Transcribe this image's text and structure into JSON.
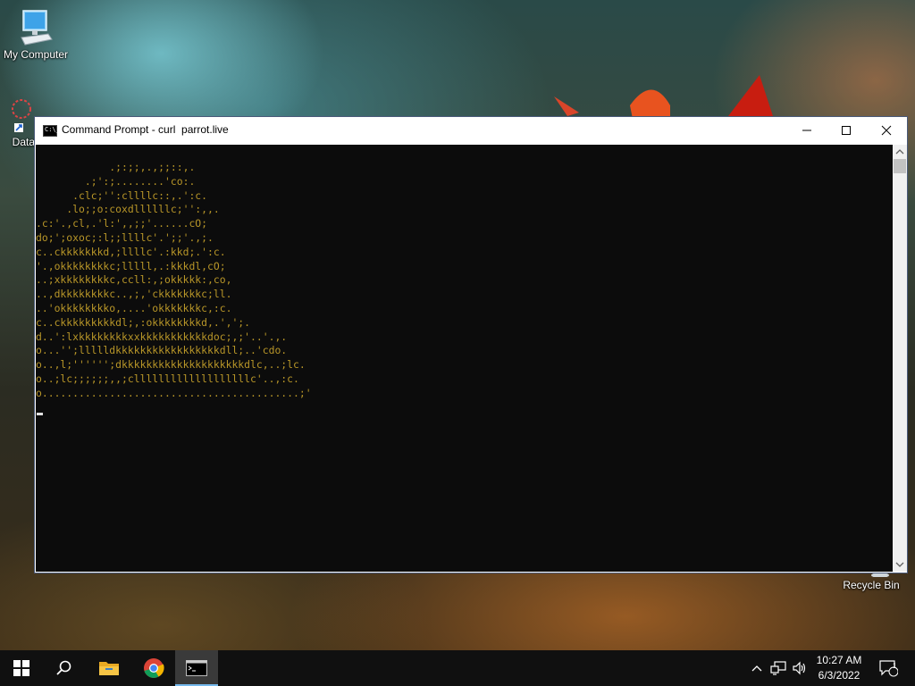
{
  "desktop": {
    "icons": [
      {
        "label": "My Computer",
        "icon": "computer-icon"
      },
      {
        "label": "DataW",
        "icon": "shortcut-icon"
      },
      {
        "label": "Recycle Bin",
        "icon": "recycle-bin-icon"
      }
    ]
  },
  "window": {
    "title": "Command Prompt - curl  parrot.live",
    "icon": "cmd-icon",
    "app_icon_text": "C:\\_",
    "controls": [
      "minimize-icon",
      "maximize-icon",
      "close-icon"
    ]
  },
  "console": {
    "text_color": "#b89628",
    "background": "#0c0c0c",
    "lines": [
      "            .;:;;,.,;;::,.",
      "        .;':;........'co:.",
      "      .clc;'':cllllc::,.':c.",
      "     .lo;;o:coxdllllllc;'':,,.",
      ".c:'.,cl,.'l:',,;;'......cO;",
      "do;';oxoc;:l;;llllc'.';;'.,;.",
      "c..ckkkkkkkd,;llllc'.:kkd;.':c.",
      "'.,okkkkkkkkc;lllll,.:kkkdl,cO;",
      "..;xkkkkkkkkc,ccll:,;okkkkk:,co,",
      "..,dkkkkkkkkc..,;,'ckkkkkkkc;ll.",
      "..'okkkkkkkko,....'okkkkkkkc,:c.",
      "c..ckkkkkkkkkdl;,:okkkkkkkkd,.',';.",
      "d..':lxkkkkkkkkxxkkkkkkkkkkkdoc;,;'..'.,.",
      "o...'';llllldkkkkkkkkkkkkkkkkkdll;..'cdo.",
      "o..,l;'''''';dkkkkkkkkkkkkkkkkkkkkdlc,..;lc.",
      "o..;lc;;;;;;,,;clllllllllllllllllllc'..,:c.",
      "o..........................................;'"
    ]
  },
  "taskbar": {
    "items": [
      {
        "name": "start-button",
        "icon": "windows-icon"
      },
      {
        "name": "search-button",
        "icon": "search-icon"
      },
      {
        "name": "file-explorer-button",
        "icon": "folder-icon"
      },
      {
        "name": "chrome-button",
        "icon": "chrome-icon"
      },
      {
        "name": "command-prompt-button",
        "icon": "cmd-icon",
        "active": true
      }
    ],
    "tray": {
      "icons": [
        "chevron-up-icon",
        "network-icon",
        "volume-icon"
      ],
      "time": "10:27 AM",
      "date": "6/3/2022",
      "notification_count": "1"
    }
  }
}
